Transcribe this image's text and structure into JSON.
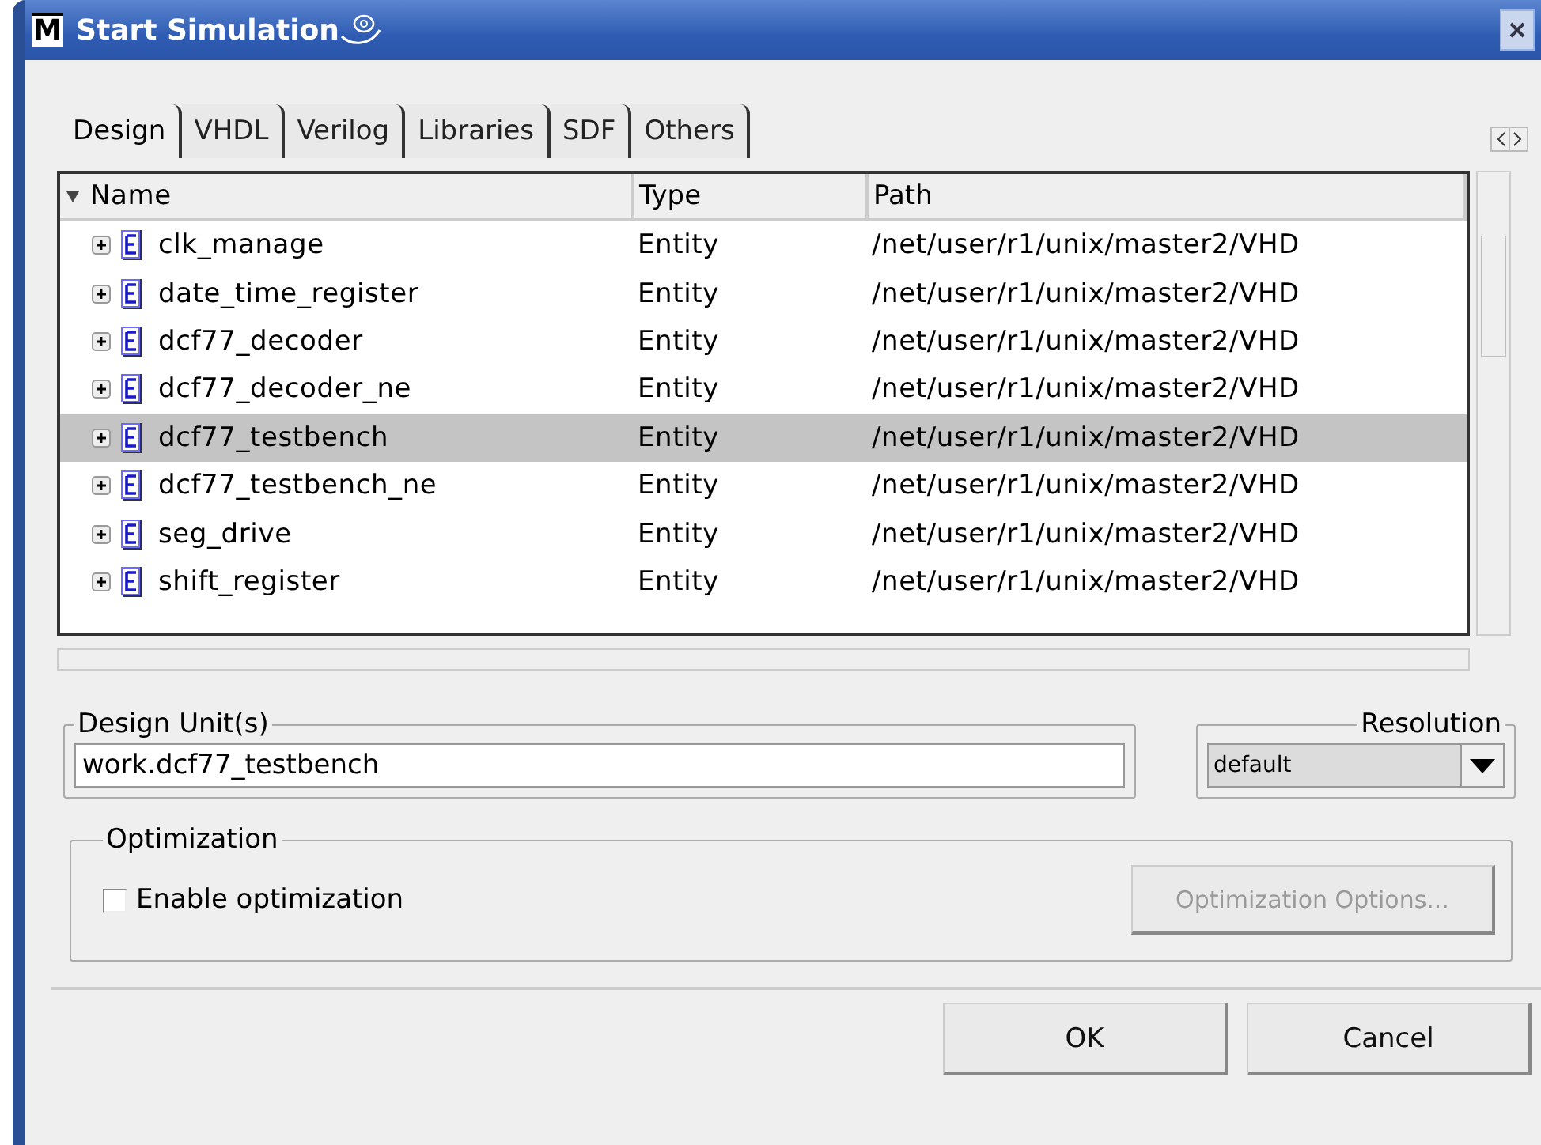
{
  "window": {
    "title": "Start Simulation",
    "app_icon": "M"
  },
  "tabs": [
    {
      "label": "Design",
      "selected": true
    },
    {
      "label": "VHDL",
      "selected": false
    },
    {
      "label": "Verilog",
      "selected": false
    },
    {
      "label": "Libraries",
      "selected": false
    },
    {
      "label": "SDF",
      "selected": false
    },
    {
      "label": "Others",
      "selected": false
    }
  ],
  "table": {
    "columns": [
      "Name",
      "Type",
      "Path"
    ],
    "rows": [
      {
        "name": "clk_manage",
        "type": "Entity",
        "path": "/net/user/r1/unix/master2/VHD",
        "selected": false,
        "expanded": false
      },
      {
        "name": "date_time_register",
        "type": "Entity",
        "path": "/net/user/r1/unix/master2/VHD",
        "selected": false,
        "expanded": false
      },
      {
        "name": "dcf77_decoder",
        "type": "Entity",
        "path": "/net/user/r1/unix/master2/VHD",
        "selected": false,
        "expanded": false
      },
      {
        "name": "dcf77_decoder_ne",
        "type": "Entity",
        "path": "/net/user/r1/unix/master2/VHD",
        "selected": false,
        "expanded": false
      },
      {
        "name": "dcf77_testbench",
        "type": "Entity",
        "path": "/net/user/r1/unix/master2/VHD",
        "selected": true,
        "expanded": false
      },
      {
        "name": "dcf77_testbench_ne",
        "type": "Entity",
        "path": "/net/user/r1/unix/master2/VHD",
        "selected": false,
        "expanded": false
      },
      {
        "name": "seg_drive",
        "type": "Entity",
        "path": "/net/user/r1/unix/master2/VHD",
        "selected": false,
        "expanded": false
      },
      {
        "name": "shift_register",
        "type": "Entity",
        "path": "/net/user/r1/unix/master2/VHD",
        "selected": false,
        "expanded": false
      }
    ]
  },
  "design_units": {
    "label": "Design Unit(s)",
    "value": "work.dcf77_testbench"
  },
  "resolution": {
    "label": "Resolution",
    "value": "default"
  },
  "optimization": {
    "label": "Optimization",
    "checkbox": {
      "label": "Enable optimization",
      "checked": false
    },
    "options_button": {
      "label": "Optimization Options...",
      "disabled": true
    }
  },
  "buttons": [
    "OK",
    "Cancel"
  ]
}
